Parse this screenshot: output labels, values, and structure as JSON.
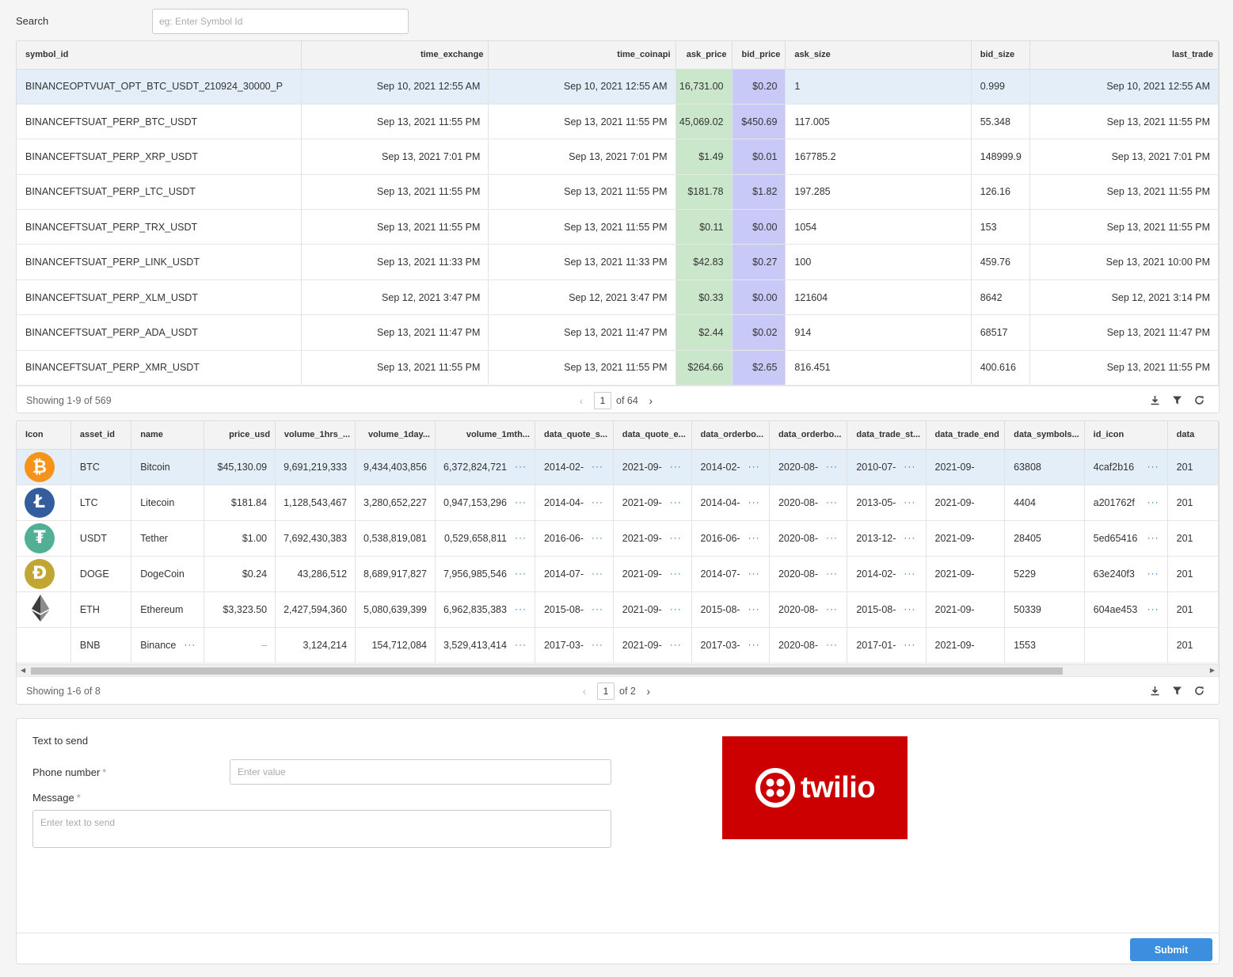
{
  "search": {
    "label": "Search",
    "placeholder": "eg: Enter Symbol Id"
  },
  "quotes_table": {
    "columns": [
      "symbol_id",
      "time_exchange",
      "time_coinapi",
      "ask_price",
      "bid_price",
      "ask_size",
      "bid_size",
      "last_trade"
    ],
    "rows": [
      [
        "BINANCEOPTVUAT_OPT_BTC_USDT_210924_30000_P",
        "Sep 10, 2021 12:55 AM",
        "Sep 10, 2021 12:55 AM",
        "16,731.00",
        "$0.20",
        "1",
        "0.999",
        "Sep 10, 2021 12:55 AM"
      ],
      [
        "BINANCEFTSUAT_PERP_BTC_USDT",
        "Sep 13, 2021 11:55 PM",
        "Sep 13, 2021 11:55 PM",
        "45,069.02",
        "$450.69",
        "117.005",
        "55.348",
        "Sep 13, 2021 11:55 PM"
      ],
      [
        "BINANCEFTSUAT_PERP_XRP_USDT",
        "Sep 13, 2021 7:01 PM",
        "Sep 13, 2021 7:01 PM",
        "$1.49",
        "$0.01",
        "167785.2",
        "148999.9",
        "Sep 13, 2021 7:01 PM"
      ],
      [
        "BINANCEFTSUAT_PERP_LTC_USDT",
        "Sep 13, 2021 11:55 PM",
        "Sep 13, 2021 11:55 PM",
        "$181.78",
        "$1.82",
        "197.285",
        "126.16",
        "Sep 13, 2021 11:55 PM"
      ],
      [
        "BINANCEFTSUAT_PERP_TRX_USDT",
        "Sep 13, 2021 11:55 PM",
        "Sep 13, 2021 11:55 PM",
        "$0.11",
        "$0.00",
        "1054",
        "153",
        "Sep 13, 2021 11:55 PM"
      ],
      [
        "BINANCEFTSUAT_PERP_LINK_USDT",
        "Sep 13, 2021 11:33 PM",
        "Sep 13, 2021 11:33 PM",
        "$42.83",
        "$0.27",
        "100",
        "459.76",
        "Sep 13, 2021 10:00 PM"
      ],
      [
        "BINANCEFTSUAT_PERP_XLM_USDT",
        "Sep 12, 2021 3:47 PM",
        "Sep 12, 2021 3:47 PM",
        "$0.33",
        "$0.00",
        "121604",
        "8642",
        "Sep 12, 2021 3:14 PM"
      ],
      [
        "BINANCEFTSUAT_PERP_ADA_USDT",
        "Sep 13, 2021 11:47 PM",
        "Sep 13, 2021 11:47 PM",
        "$2.44",
        "$0.02",
        "914",
        "68517",
        "Sep 13, 2021 11:47 PM"
      ],
      [
        "BINANCEFTSUAT_PERP_XMR_USDT",
        "Sep 13, 2021 11:55 PM",
        "Sep 13, 2021 11:55 PM",
        "$264.66",
        "$2.65",
        "816.451",
        "400.616",
        "Sep 13, 2021 11:55 PM"
      ]
    ],
    "showing": "Showing 1-9 of 569",
    "page": "1",
    "of_pages": "of 64"
  },
  "assets_table": {
    "columns": [
      "Icon",
      "asset_id",
      "name",
      "price_usd",
      "volume_1hrs_...",
      "volume_1day...",
      "volume_1mth...",
      "data_quote_s...",
      "data_quote_e...",
      "data_orderbo...",
      "data_orderbo...",
      "data_trade_st...",
      "data_trade_end",
      "data_symbols...",
      "id_icon",
      "data"
    ],
    "rows": [
      {
        "icon": "bitcoin-icon",
        "color": "#f7931a",
        "glyph": "₿",
        "cells": [
          "BTC",
          "Bitcoin",
          "$45,130.09",
          "9,691,219,333",
          "9,434,403,856",
          "6,372,824,721",
          "2014-02-",
          "2021-09-",
          "2014-02-",
          "2020-08-",
          "2010-07-",
          "2021-09-",
          "63808",
          "4caf2b16",
          "201"
        ],
        "name_more": false,
        "id_more": true
      },
      {
        "icon": "litecoin-icon",
        "color": "#345d9d",
        "glyph": "Ł",
        "cells": [
          "LTC",
          "Litecoin",
          "$181.84",
          "1,128,543,467",
          "3,280,652,227",
          "0,947,153,296",
          "2014-04-",
          "2021-09-",
          "2014-04-",
          "2020-08-",
          "2013-05-",
          "2021-09-",
          "4404",
          "a201762f",
          "201"
        ],
        "name_more": false,
        "id_more": true
      },
      {
        "icon": "tether-icon",
        "color": "#50af95",
        "glyph": "₮",
        "cells": [
          "USDT",
          "Tether",
          "$1.00",
          "7,692,430,383",
          "0,538,819,081",
          "0,529,658,811",
          "2016-06-",
          "2021-09-",
          "2016-06-",
          "2020-08-",
          "2013-12-",
          "2021-09-",
          "28405",
          "5ed65416",
          "201"
        ],
        "name_more": false,
        "id_more": true
      },
      {
        "icon": "dogecoin-icon",
        "color": "#c2a633",
        "glyph": "Ð",
        "cells": [
          "DOGE",
          "DogeCoin",
          "$0.24",
          "43,286,512",
          "8,689,917,827",
          "7,956,985,546",
          "2014-07-",
          "2021-09-",
          "2014-07-",
          "2020-08-",
          "2014-02-",
          "2021-09-",
          "5229",
          "63e240f3",
          "201"
        ],
        "name_more": false,
        "id_more": true
      },
      {
        "icon": "ethereum-icon",
        "color": "#3c3c3d",
        "glyph": "",
        "cells": [
          "ETH",
          "Ethereum",
          "$3,323.50",
          "2,427,594,360",
          "5,080,639,399",
          "6,962,835,383",
          "2015-08-",
          "2021-09-",
          "2015-08-",
          "2020-08-",
          "2015-08-",
          "2021-09-",
          "50339",
          "604ae453",
          "201"
        ],
        "name_more": false,
        "id_more": true
      },
      {
        "icon": "",
        "color": "",
        "glyph": "",
        "cells": [
          "BNB",
          "Binance",
          "–",
          "3,124,214",
          "154,712,084",
          "3,529,413,414",
          "2017-03-",
          "2021-09-",
          "2017-03-",
          "2020-08-",
          "2017-01-",
          "2021-09-",
          "1553",
          "",
          "201"
        ],
        "name_more": true,
        "id_more": false
      }
    ],
    "showing": "Showing 1-6 of 8",
    "page": "1",
    "of_pages": "of 2"
  },
  "form": {
    "title": "Text to send",
    "phone_label": "Phone number",
    "phone_placeholder": "Enter value",
    "message_label": "Message",
    "message_placeholder": "Enter text to send",
    "required_mark": "*",
    "submit": "Submit",
    "logo_text": "twilio"
  },
  "colors": {
    "ask": "#cbe7cb",
    "bid": "#c9c9f7",
    "selected": "#e3eef9",
    "twilio": "#cc0000",
    "accent": "#3b8fde"
  }
}
